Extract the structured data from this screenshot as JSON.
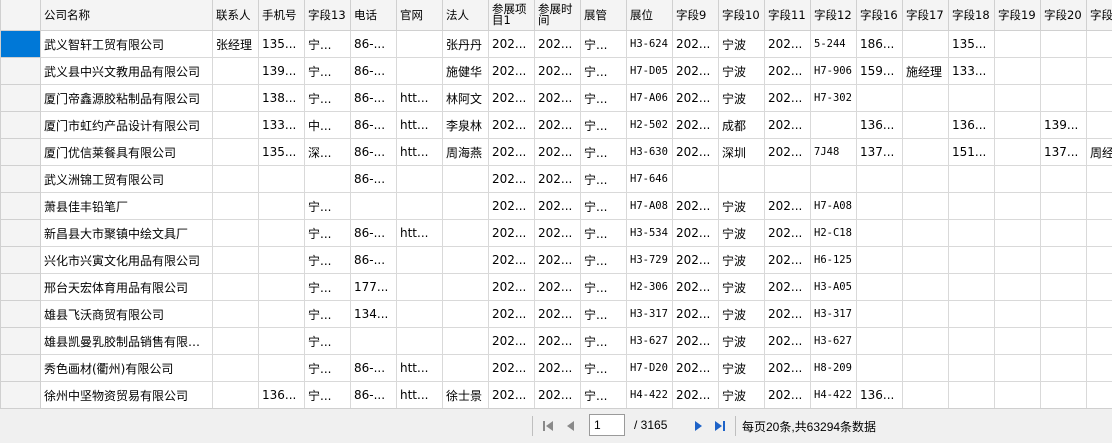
{
  "columns": [
    "公司名称",
    "联系人",
    "手机号",
    "字段13",
    "电话",
    "官网",
    "法人",
    "参展项目1",
    "参展时间",
    "展管",
    "展位",
    "字段9",
    "字段10",
    "字段11",
    "字段12",
    "字段16",
    "字段17",
    "字段18",
    "字段19",
    "字段20",
    "字段"
  ],
  "rows": [
    [
      "武义智轩工贸有限公司",
      "张经理",
      "135...",
      "宁...",
      "86-...",
      "",
      "张丹丹",
      "202...",
      "202...",
      "宁...",
      "H3-624",
      "202...",
      "宁波",
      "202...",
      "5-244",
      "186...",
      "",
      "135...",
      "",
      "",
      ""
    ],
    [
      "武义县中兴文教用品有限公司",
      "",
      "139...",
      "宁...",
      "86-...",
      "",
      "施健华",
      "202...",
      "202...",
      "宁...",
      "H7-D05",
      "202...",
      "宁波",
      "202...",
      "H7-906",
      "159...",
      "施经理",
      "133...",
      "",
      "",
      ""
    ],
    [
      "厦门帝鑫源胶粘制品有限公司",
      "",
      "138...",
      "宁...",
      "86-...",
      "htt...",
      "林阿文",
      "202...",
      "202...",
      "宁...",
      "H7-A06",
      "202...",
      "宁波",
      "202...",
      "H7-302",
      "",
      "",
      "",
      "",
      "",
      ""
    ],
    [
      "厦门市虹约产品设计有限公司",
      "",
      "133...",
      "中...",
      "86-...",
      "htt...",
      "李泉林",
      "202...",
      "202...",
      "宁...",
      "H2-502",
      "202...",
      "成都",
      "202...",
      "",
      "136...",
      "",
      "136...",
      "",
      "139...",
      ""
    ],
    [
      "厦门优信莱餐具有限公司",
      "",
      "135...",
      "深...",
      "86-...",
      "htt...",
      "周海燕",
      "202...",
      "202...",
      "宁...",
      "H3-630",
      "202...",
      "深圳",
      "202...",
      "7J48",
      "137...",
      "",
      "151...",
      "",
      "137...",
      "周经"
    ],
    [
      "武义洲锦工贸有限公司",
      "",
      "",
      "",
      "86-...",
      "",
      "",
      "202...",
      "202...",
      "宁...",
      "H7-646",
      "",
      "",
      "",
      "",
      "",
      "",
      "",
      "",
      "",
      ""
    ],
    [
      "萧县佳丰铅笔厂",
      "",
      "",
      "宁...",
      "",
      "",
      "",
      "202...",
      "202...",
      "宁...",
      "H7-A08",
      "202...",
      "宁波",
      "202...",
      "H7-A08",
      "",
      "",
      "",
      "",
      "",
      ""
    ],
    [
      "新昌县大市聚镇中绘文具厂",
      "",
      "",
      "宁...",
      "86-...",
      "htt...",
      "",
      "202...",
      "202...",
      "宁...",
      "H3-534",
      "202...",
      "宁波",
      "202...",
      "H2-C18",
      "",
      "",
      "",
      "",
      "",
      ""
    ],
    [
      "兴化市兴寅文化用品有限公司",
      "",
      "",
      "宁...",
      "86-...",
      "",
      "",
      "202...",
      "202...",
      "宁...",
      "H3-729",
      "202...",
      "宁波",
      "202...",
      "H6-125",
      "",
      "",
      "",
      "",
      "",
      ""
    ],
    [
      "邢台天宏体育用品有限公司",
      "",
      "",
      "宁...",
      "177...",
      "",
      "",
      "202...",
      "202...",
      "宁...",
      "H2-306",
      "202...",
      "宁波",
      "202...",
      "H3-A05",
      "",
      "",
      "",
      "",
      "",
      ""
    ],
    [
      "雄县飞沃商贸有限公司",
      "",
      "",
      "宁...",
      "134...",
      "",
      "",
      "202...",
      "202...",
      "宁...",
      "H3-317",
      "202...",
      "宁波",
      "202...",
      "H3-317",
      "",
      "",
      "",
      "",
      "",
      ""
    ],
    [
      "雄县凯曼乳胶制品销售有限公司",
      "",
      "",
      "宁...",
      "",
      "",
      "",
      "202...",
      "202...",
      "宁...",
      "H3-627",
      "202...",
      "宁波",
      "202...",
      "H3-627",
      "",
      "",
      "",
      "",
      "",
      ""
    ],
    [
      "秀色画材(衢州)有限公司",
      "",
      "",
      "宁...",
      "86-...",
      "htt...",
      "",
      "202...",
      "202...",
      "宁...",
      "H7-D20",
      "202...",
      "宁波",
      "202...",
      "H8-209",
      "",
      "",
      "",
      "",
      "",
      ""
    ],
    [
      "徐州中坚物资贸易有限公司",
      "",
      "136...",
      "宁...",
      "86-...",
      "htt...",
      "徐士景",
      "202...",
      "202...",
      "宁...",
      "H4-422",
      "202...",
      "宁波",
      "202...",
      "H4-422",
      "136...",
      "",
      "",
      "",
      "",
      ""
    ]
  ],
  "pager": {
    "current_page": "1",
    "total_label": "/  3165",
    "summary": "每页20条,共63294条数据"
  }
}
